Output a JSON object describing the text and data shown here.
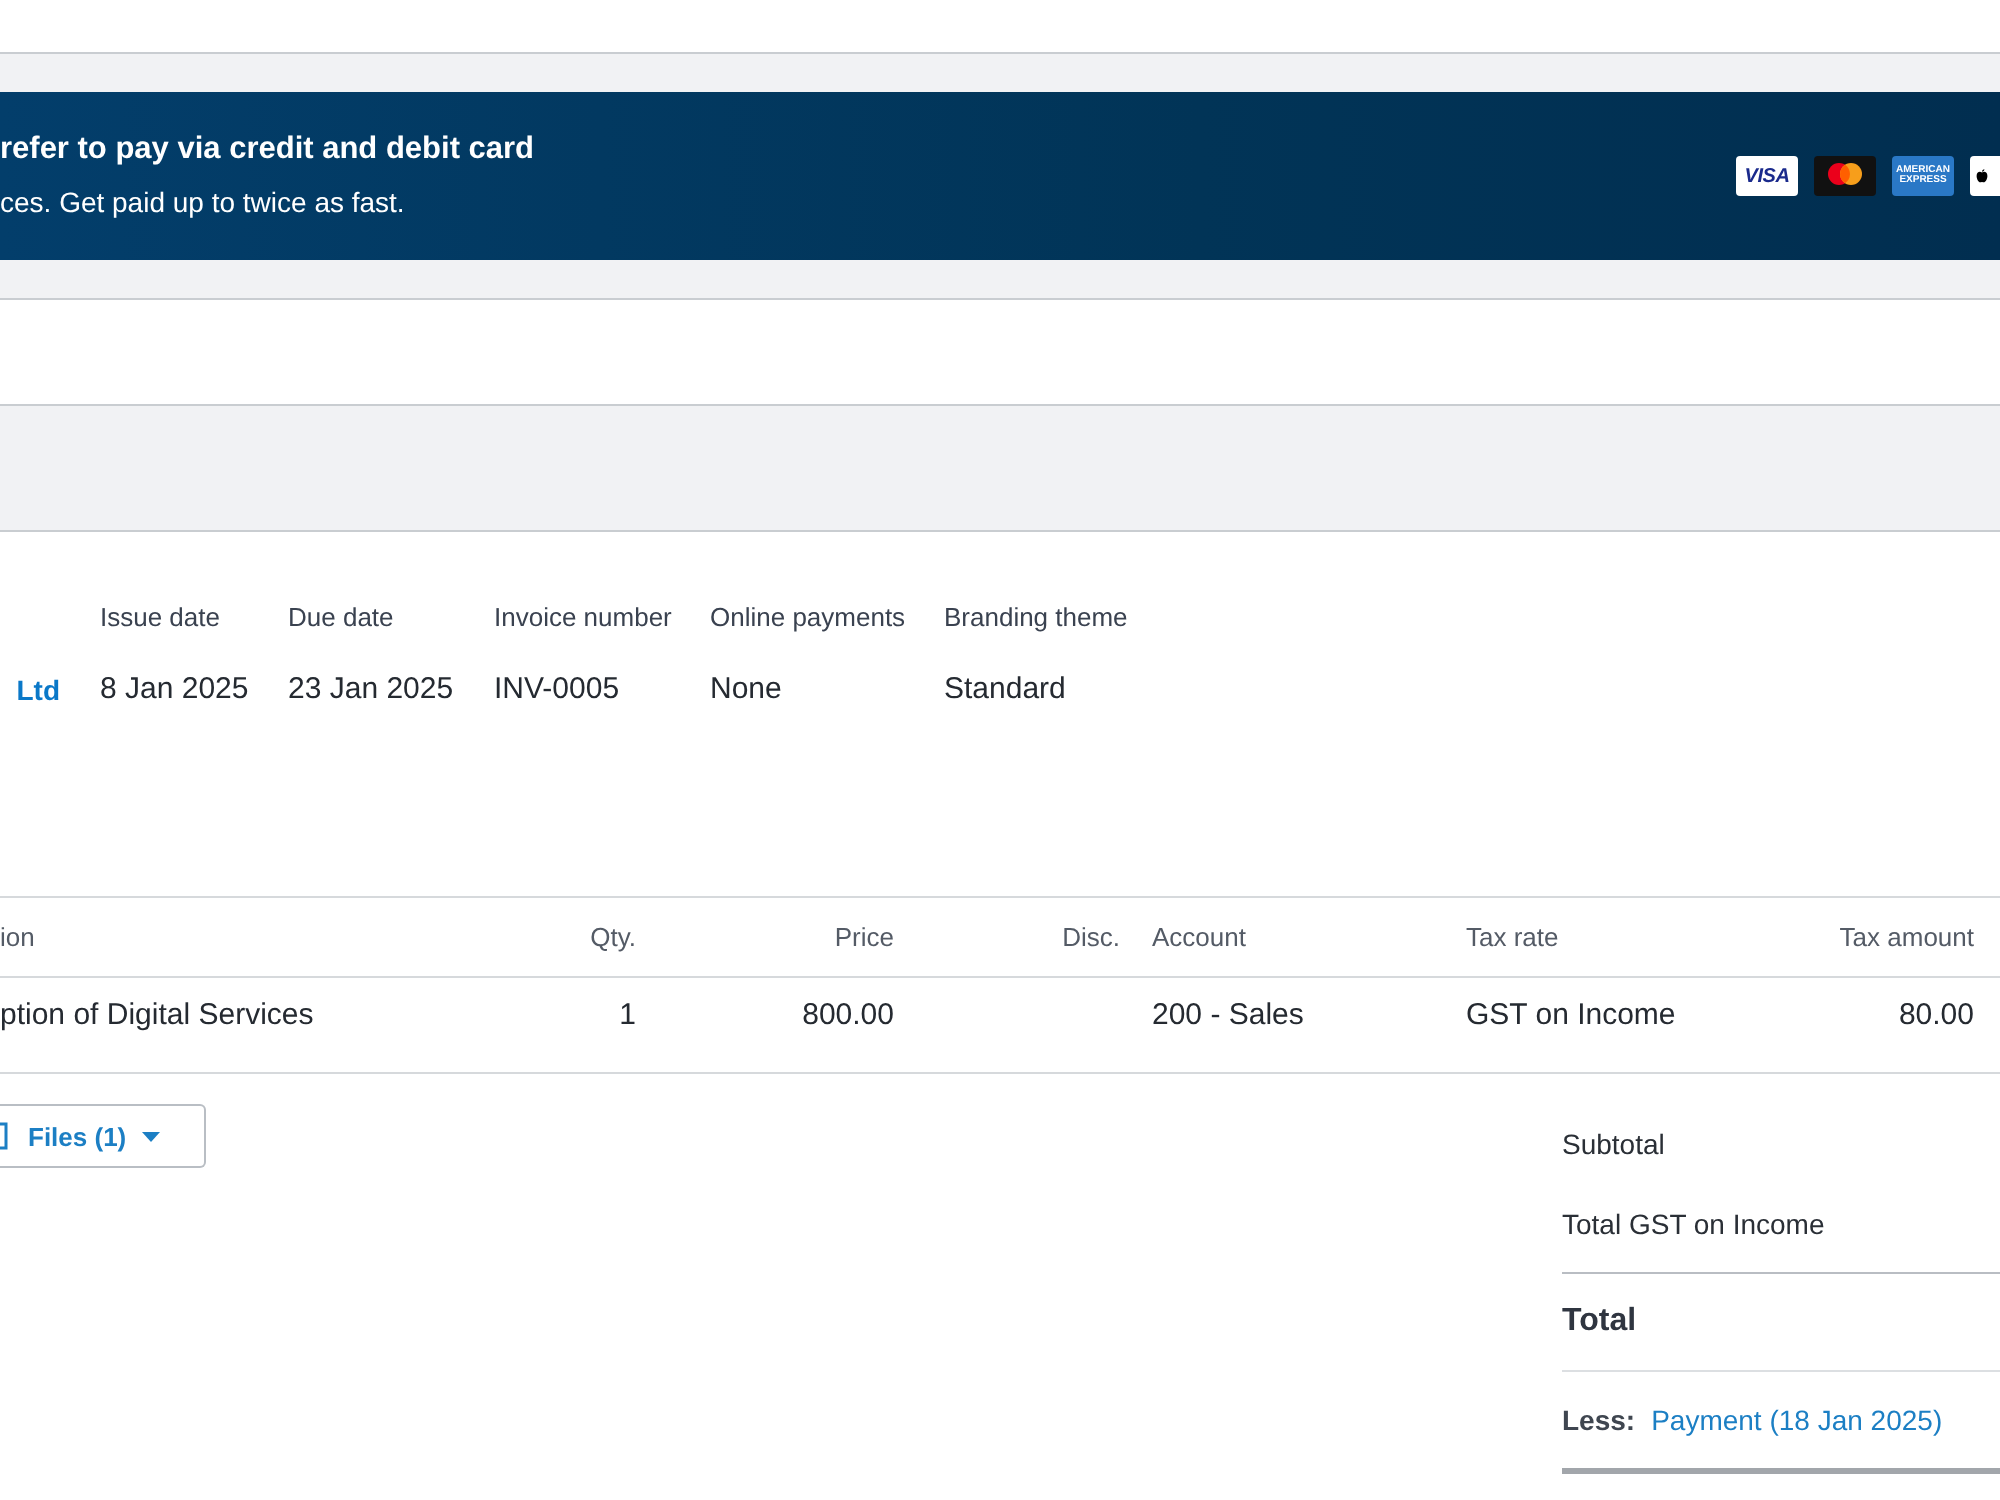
{
  "banner": {
    "title": "refer to pay via credit and debit card",
    "subtitle": "ces. Get paid up to twice as fast.",
    "card_logos": [
      {
        "kind": "visa",
        "label": "VISA"
      },
      {
        "kind": "mastercard"
      },
      {
        "kind": "amex",
        "label": "AMERICAN EXPRESS"
      },
      {
        "kind": "wallet"
      }
    ]
  },
  "invoice_details": {
    "contact": "Ltd",
    "fields": [
      {
        "label": "Issue date",
        "value": "8 Jan 2025"
      },
      {
        "label": "Due date",
        "value": "23 Jan 2025"
      },
      {
        "label": "Invoice number",
        "value": "INV-0005"
      },
      {
        "label": "Online payments",
        "value": "None"
      },
      {
        "label": "Branding theme",
        "value": "Standard"
      }
    ]
  },
  "line_items": {
    "columns": [
      {
        "label": "ion",
        "kind": "text"
      },
      {
        "label": "Qty.",
        "kind": "number"
      },
      {
        "label": "Price",
        "kind": "number"
      },
      {
        "label": "Disc.",
        "kind": "number"
      },
      {
        "label": "Account",
        "kind": "text"
      },
      {
        "label": "Tax rate",
        "kind": "text"
      },
      {
        "label": "Tax amount",
        "kind": "number"
      }
    ],
    "rows": [
      {
        "cells": [
          "ption of Digital Services",
          "1",
          "800.00",
          null,
          "200 - Sales",
          "GST on Income",
          "80.00"
        ]
      }
    ]
  },
  "attachments_button": {
    "label": "Files (1)"
  },
  "totals": [
    {
      "kind": "line",
      "label": "Subtotal"
    },
    {
      "kind": "line",
      "label": "Total GST on Income"
    },
    {
      "kind": "total",
      "label": "Total"
    },
    {
      "kind": "payment",
      "prefix": "Less:",
      "link": "Payment (18 Jan 2025)"
    }
  ]
}
